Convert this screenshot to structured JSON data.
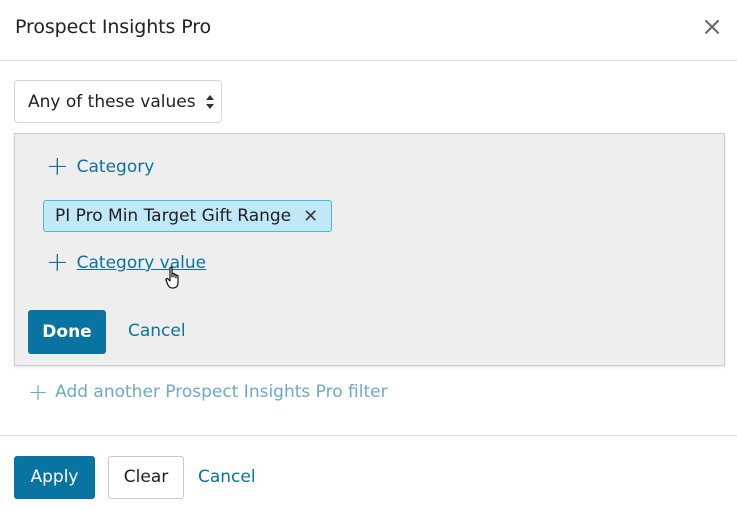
{
  "dialog": {
    "title": "Prospect Insights Pro",
    "close_icon": "close-icon"
  },
  "match_select": {
    "selected": "Any of these values",
    "caret_icon": "sort-caret-icon"
  },
  "panel": {
    "add_category_label": "Category",
    "chip_label": "PI Pro Min Target Gift Range",
    "add_value_label": "Category value",
    "done_label": "Done",
    "cancel_label": "Cancel"
  },
  "add_filter_label": "Add another Prospect Insights Pro filter",
  "footer": {
    "apply_label": "Apply",
    "clear_label": "Clear",
    "cancel_label": "Cancel"
  },
  "colors": {
    "primary": "#0974a1",
    "chip_bg": "#c1e8f7",
    "chip_border": "#4ab5e0",
    "panel_bg": "#eeeeee",
    "muted_link": "#6aaac6"
  }
}
